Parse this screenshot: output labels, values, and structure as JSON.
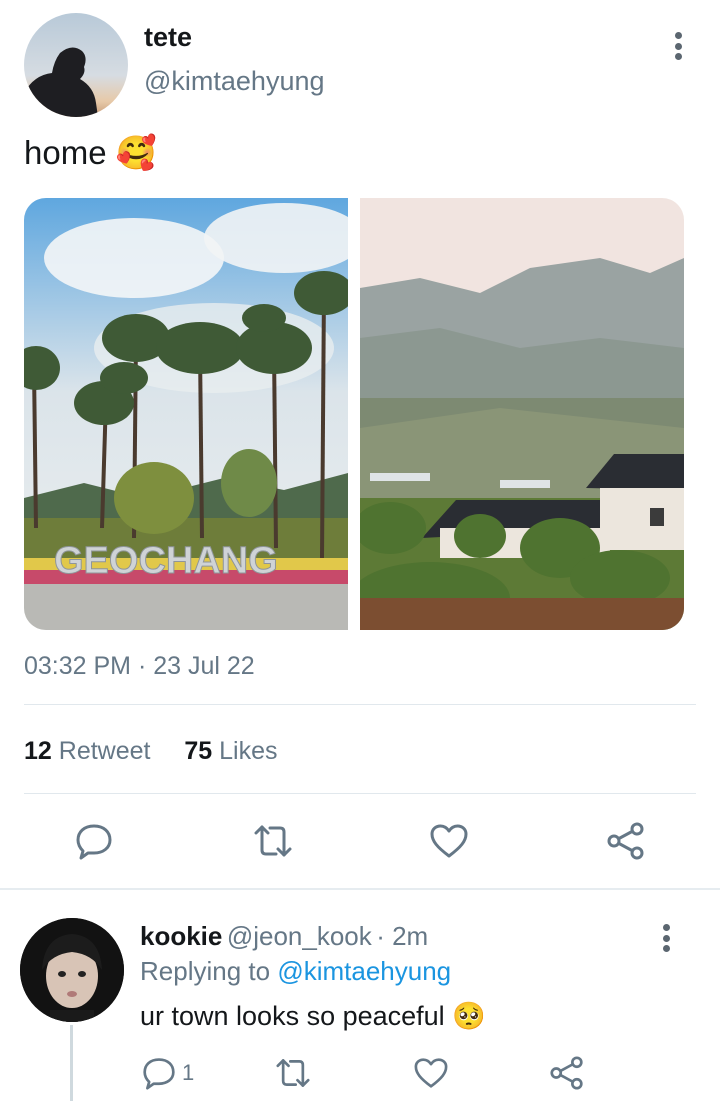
{
  "tweet": {
    "author_name": "tete",
    "author_handle": "@kimtaehyung",
    "text": "home",
    "emoji": "🥰",
    "timestamp": "03:32 PM · 23 Jul 22",
    "retweet_count": "12",
    "retweet_label": "Retweet",
    "like_count": "75",
    "like_label": "Likes",
    "photos": [
      {
        "caption_text": "GEOCHANG"
      },
      {
        "caption_text": ""
      }
    ]
  },
  "reply": {
    "author_name": "kookie",
    "author_handle": "@jeon_kook",
    "time": "· 2m",
    "replying_to_label": "Replying to",
    "replying_to_handle": "@kimtaehyung",
    "text": "ur town looks so peaceful",
    "emoji": "🥺",
    "reply_count": "1"
  },
  "icons": [
    "more-vertical-icon",
    "reply-icon",
    "retweet-icon",
    "like-icon",
    "share-icon"
  ],
  "colors": {
    "link": "#1b95e0",
    "muted": "#657786",
    "text": "#14171a",
    "divider": "#e1e8ed"
  }
}
